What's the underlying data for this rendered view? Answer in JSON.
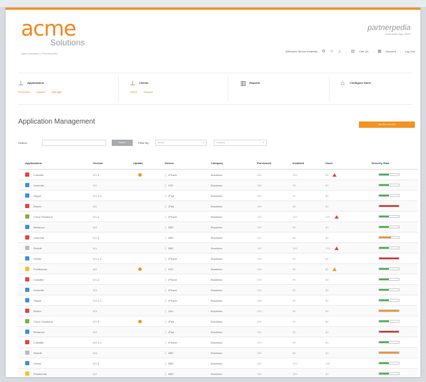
{
  "brand": {
    "logo": "acme",
    "logo_sub": "Solutions",
    "tagline": "Apps Manager | Partnerpedia",
    "right_main": "partnerpedia",
    "right_sub": "Enterprise App Store"
  },
  "userbar": {
    "welcome": "Welcome Simon Andrews",
    "cart": "Cart (3)",
    "account": "Account",
    "logout": "Log Out"
  },
  "nav": [
    {
      "title": "Applications",
      "icon": "applications-icon",
      "subs": [
        "Purchase",
        "Upload",
        "Manage"
      ]
    },
    {
      "title": "Clients",
      "icon": "clients-icon",
      "subs": [
        "Users",
        "Groups"
      ]
    },
    {
      "title": "Reports",
      "icon": "reports-icon",
      "subs": []
    },
    {
      "title": "Configure Store",
      "icon": "store-icon",
      "subs": []
    }
  ],
  "page_title": "Application Management",
  "primary_button": "Add New Licenses",
  "filters": {
    "search_label": "Search",
    "search_button": "Search",
    "filter_label": "Filter By",
    "device_select": "Device",
    "category_select": "Category"
  },
  "table": {
    "headers": [
      "Applications",
      "Version",
      "Update",
      "Device",
      "Category",
      "Purchased",
      "Installed",
      "Used",
      "Security Risk"
    ],
    "rows": [
      {
        "name": "Cobaltic",
        "icon_color": "#e04646",
        "version": "V.1.0",
        "update": true,
        "device": "iPhone",
        "category": "Business",
        "purchased": "100",
        "installed": "100",
        "used": "85",
        "warn": "#e04646",
        "risk": 0.5,
        "risk_color": "#3fb548"
      },
      {
        "name": "LinkedIn",
        "icon_color": "#3d8fd8",
        "version": "V.1",
        "update": false,
        "device": "iOS",
        "category": "Business",
        "purchased": "100",
        "installed": "95",
        "used": "80",
        "warn": "",
        "risk": 0.5,
        "risk_color": "#3fb548"
      },
      {
        "name": "Skype",
        "icon_color": "#3d8fd8",
        "version": "V.2.1.1",
        "update": false,
        "device": "iPad",
        "category": "Business",
        "purchased": "100",
        "installed": "90",
        "used": "80",
        "warn": "",
        "risk": 0.5,
        "risk_color": "#3fb548"
      },
      {
        "name": "Bravio",
        "icon_color": "#e04646",
        "version": "V.1",
        "update": false,
        "device": "iPad",
        "category": "Business",
        "purchased": "100",
        "installed": "90",
        "used": "80",
        "warn": "",
        "risk": 1.0,
        "risk_color": "#d9342b"
      },
      {
        "name": "Cisco Solutions",
        "icon_color": "#7cb342",
        "version": "V.1.2",
        "update": false,
        "device": "iPhone",
        "category": "Business",
        "purchased": "100",
        "installed": "100",
        "used": "100",
        "warn": "#e04646",
        "risk": 0.5,
        "risk_color": "#3fb548"
      },
      {
        "name": "Behance",
        "icon_color": "#3d8fd8",
        "version": "V.2",
        "update": false,
        "device": "BB7",
        "category": "Business",
        "purchased": "100",
        "installed": "85",
        "used": "80",
        "warn": "",
        "risk": 0.5,
        "risk_color": "#3fb548"
      },
      {
        "name": "Lisbonia",
        "icon_color": "#e04646",
        "version": "V.1.2",
        "update": false,
        "device": "BB7",
        "category": "Business",
        "purchased": "100",
        "installed": "85",
        "used": "80",
        "warn": "",
        "risk": 0.6,
        "risk_color": "#f29422"
      },
      {
        "name": "Reddit",
        "icon_color": "#bbbbbb",
        "version": "V.1",
        "update": false,
        "device": "BB7",
        "category": "Business",
        "purchased": "100",
        "installed": "100",
        "used": "100",
        "warn": "#e04646",
        "risk": 0.5,
        "risk_color": "#3fb548"
      },
      {
        "name": "Vimeo",
        "icon_color": "#3d8fd8",
        "version": "V.2.1.1",
        "update": false,
        "device": "iPhone",
        "category": "Business",
        "purchased": "100",
        "installed": "90",
        "used": "80",
        "warn": "",
        "risk": 1.0,
        "risk_color": "#d9342b"
      },
      {
        "name": "Pointbreak",
        "icon_color": "#f2c02e",
        "version": "V.2",
        "update": true,
        "device": "iOS",
        "category": "Business",
        "purchased": "100",
        "installed": "90",
        "used": "80",
        "warn": "#f29422",
        "risk": 0.5,
        "risk_color": "#3fb548"
      },
      {
        "name": "Cobaltic",
        "icon_color": "#e04646",
        "version": "V.1.2",
        "update": false,
        "device": "iPhone",
        "category": "Business",
        "purchased": "100",
        "installed": "95",
        "used": "80",
        "warn": "",
        "risk": 0.5,
        "risk_color": "#3fb548"
      },
      {
        "name": "LinkedIn",
        "icon_color": "#3d8fd8",
        "version": "V.3",
        "update": false,
        "device": "iPhone",
        "category": "Business",
        "purchased": "100",
        "installed": "90",
        "used": "80",
        "warn": "",
        "risk": 0.5,
        "risk_color": "#3fb548"
      },
      {
        "name": "Skype",
        "icon_color": "#3d8fd8",
        "version": "V.2.1.1",
        "update": false,
        "device": "iPhone",
        "category": "Business",
        "purchased": "100",
        "installed": "90",
        "used": "80",
        "warn": "",
        "risk": 0.5,
        "risk_color": "#3fb548"
      },
      {
        "name": "Bravio",
        "icon_color": "#e04646",
        "version": "V.3",
        "update": false,
        "device": "Dev",
        "category": "Business",
        "purchased": "100",
        "installed": "85",
        "used": "80",
        "warn": "",
        "risk": 1.0,
        "risk_color": "#f29422"
      },
      {
        "name": "Cisco Solutions",
        "icon_color": "#7cb342",
        "version": "V.1.0",
        "update": true,
        "device": "iPad",
        "category": "Business",
        "purchased": "100",
        "installed": "90",
        "used": "80",
        "warn": "",
        "risk": 0.5,
        "risk_color": "#3fb548"
      },
      {
        "name": "Behance",
        "icon_color": "#3d8fd8",
        "version": "V.2",
        "update": false,
        "device": "iPad",
        "category": "Business",
        "purchased": "100",
        "installed": "90",
        "used": "80",
        "warn": "",
        "risk": 1.0,
        "risk_color": "#d9342b"
      },
      {
        "name": "Cobaltic",
        "icon_color": "#e04646",
        "version": "V.2.1.1",
        "update": false,
        "device": "iPhone",
        "category": "Business",
        "purchased": "100",
        "installed": "90",
        "used": "80",
        "warn": "",
        "risk": 0.5,
        "risk_color": "#3fb548"
      },
      {
        "name": "Reddit",
        "icon_color": "#bbbbbb",
        "version": "V.3",
        "update": false,
        "device": "BB7",
        "category": "Business",
        "purchased": "100",
        "installed": "85",
        "used": "80",
        "warn": "",
        "risk": 1.0,
        "risk_color": "#f29422"
      },
      {
        "name": "Vimeo",
        "icon_color": "#3d8fd8",
        "version": "V.1.2",
        "update": false,
        "device": "BB7",
        "category": "Business",
        "purchased": "100",
        "installed": "100",
        "used": "100",
        "warn": "",
        "risk": 0.5,
        "risk_color": "#3fb548"
      },
      {
        "name": "Pointbreak",
        "icon_color": "#f2c02e",
        "version": "V.2",
        "update": false,
        "device": "BB7",
        "category": "Business",
        "purchased": "100",
        "installed": "100",
        "used": "80",
        "warn": "",
        "risk": 0.5,
        "risk_color": "#3fb548"
      }
    ]
  }
}
